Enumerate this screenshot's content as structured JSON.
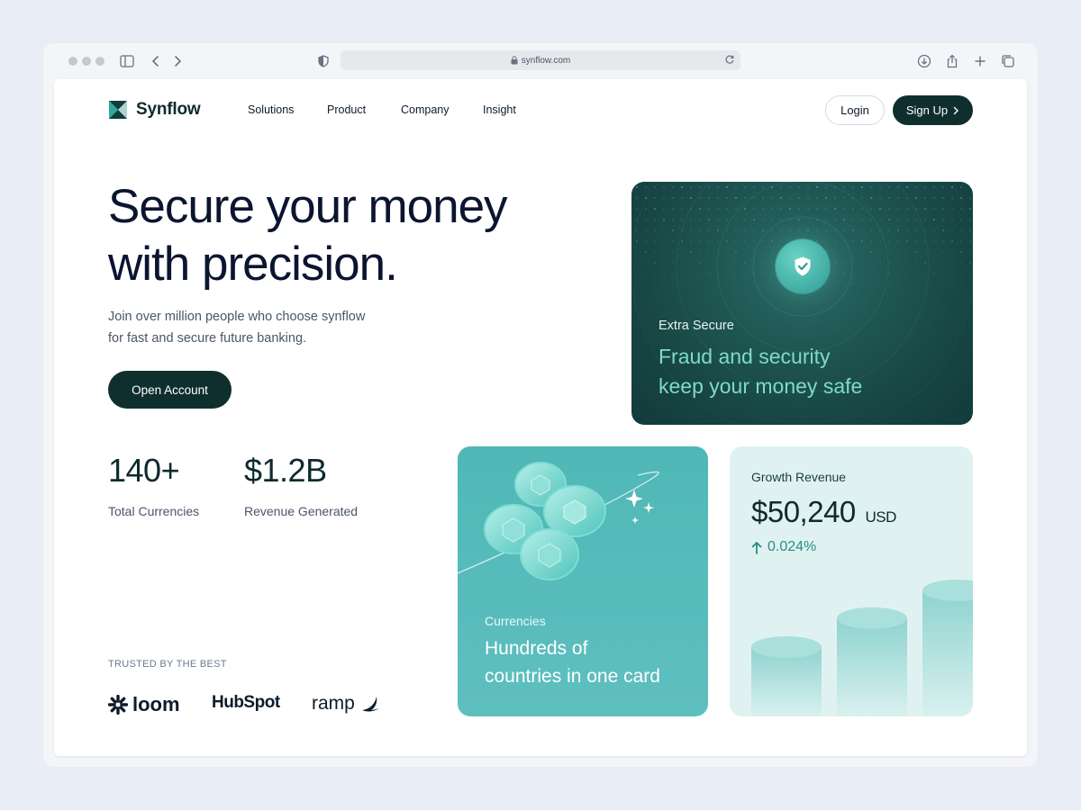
{
  "browser": {
    "url": "synflow.com"
  },
  "header": {
    "brand": "Synflow",
    "nav": [
      {
        "label": "Solutions"
      },
      {
        "label": "Product"
      },
      {
        "label": "Company"
      },
      {
        "label": "Insight"
      }
    ],
    "login_label": "Login",
    "signup_label": "Sign Up"
  },
  "hero": {
    "title_lines": [
      "Secure your money",
      "with precision."
    ],
    "subtitle_lines": [
      "Join over million people who choose synflow",
      "for fast and secure future banking."
    ],
    "cta_label": "Open Account"
  },
  "stats": [
    {
      "value": "140+",
      "label": "Total Currencies"
    },
    {
      "value": "$1.2B",
      "label": "Revenue Generated"
    }
  ],
  "trusted": {
    "heading": "TRUSTED BY THE BEST",
    "brands": [
      "loom",
      "HubSpot",
      "ramp"
    ]
  },
  "cards": {
    "secure": {
      "label": "Extra Secure",
      "title_lines": [
        "Fraud and security",
        "keep your money safe"
      ],
      "icon": "shield-check-icon"
    },
    "currencies": {
      "label": "Currencies",
      "title_lines": [
        "Hundreds of",
        "countries in one card"
      ]
    },
    "revenue": {
      "label": "Growth Revenue",
      "amount": "$50,240",
      "unit": "USD",
      "change": "0.024%",
      "bar_levels": [
        0.55,
        0.78,
        1.0
      ]
    }
  },
  "colors": {
    "primary_dark": "#0f2f2f",
    "accent_teal": "#7fd9cc",
    "card_teal": "#4fb8b6",
    "card_mint": "#dff2f1",
    "heading_navy": "#0b1530"
  }
}
